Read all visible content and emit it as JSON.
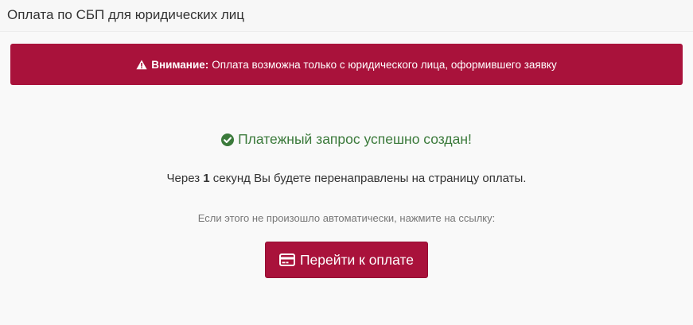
{
  "header": {
    "title": "Оплата по СБП для юридических лиц"
  },
  "alert": {
    "icon": "warning-icon",
    "strong": "Внимание:",
    "text": "Оплата возможна только с юридического лица, оформившего заявку",
    "color": "#a9123b"
  },
  "success": {
    "icon": "check-circle-icon",
    "text": "Платежный запрос успешно создан!",
    "color": "#3b7a3b"
  },
  "redirect": {
    "prefix": "Через",
    "seconds": "1",
    "suffix": "секунд Вы будете перенаправлены на страницу оплаты."
  },
  "hint": {
    "text": "Если этого не произошло автоматически, нажмите на ссылку:"
  },
  "pay_button": {
    "icon": "credit-card-icon",
    "label": "Перейти к оплате",
    "color": "#a9123b"
  }
}
